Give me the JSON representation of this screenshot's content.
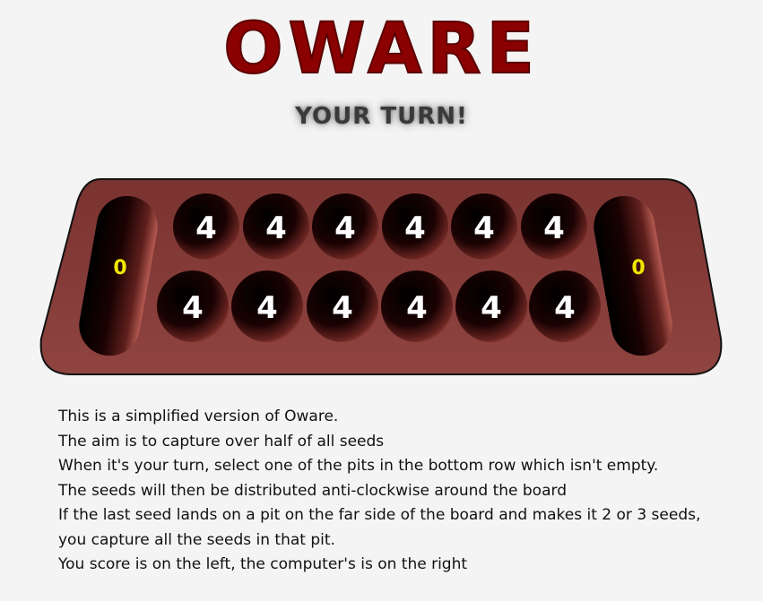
{
  "game": {
    "title": "OWARE",
    "status": "YOUR TURN!"
  },
  "board": {
    "player_store": "0",
    "computer_store": "0",
    "top_row": [
      "4",
      "4",
      "4",
      "4",
      "4",
      "4"
    ],
    "bottom_row": [
      "4",
      "4",
      "4",
      "4",
      "4",
      "4"
    ]
  },
  "colors": {
    "title": "#8b0000",
    "board": "#8a3d3a",
    "pit": "#1a0000",
    "store_label": "#f2e600",
    "pit_label": "#ffffff"
  },
  "instructions": [
    "This is a simplified version of Oware.",
    "The aim is to capture over half of all seeds",
    "When it's your turn, select one of the pits in the bottom row which isn't empty.",
    "The seeds will then be distributed anti-clockwise around the board",
    "If the last seed lands on a pit on the far side of the board and makes it 2 or 3 seeds, you capture all the seeds in that pit.",
    "You score is on the left, the computer's is on the right"
  ]
}
